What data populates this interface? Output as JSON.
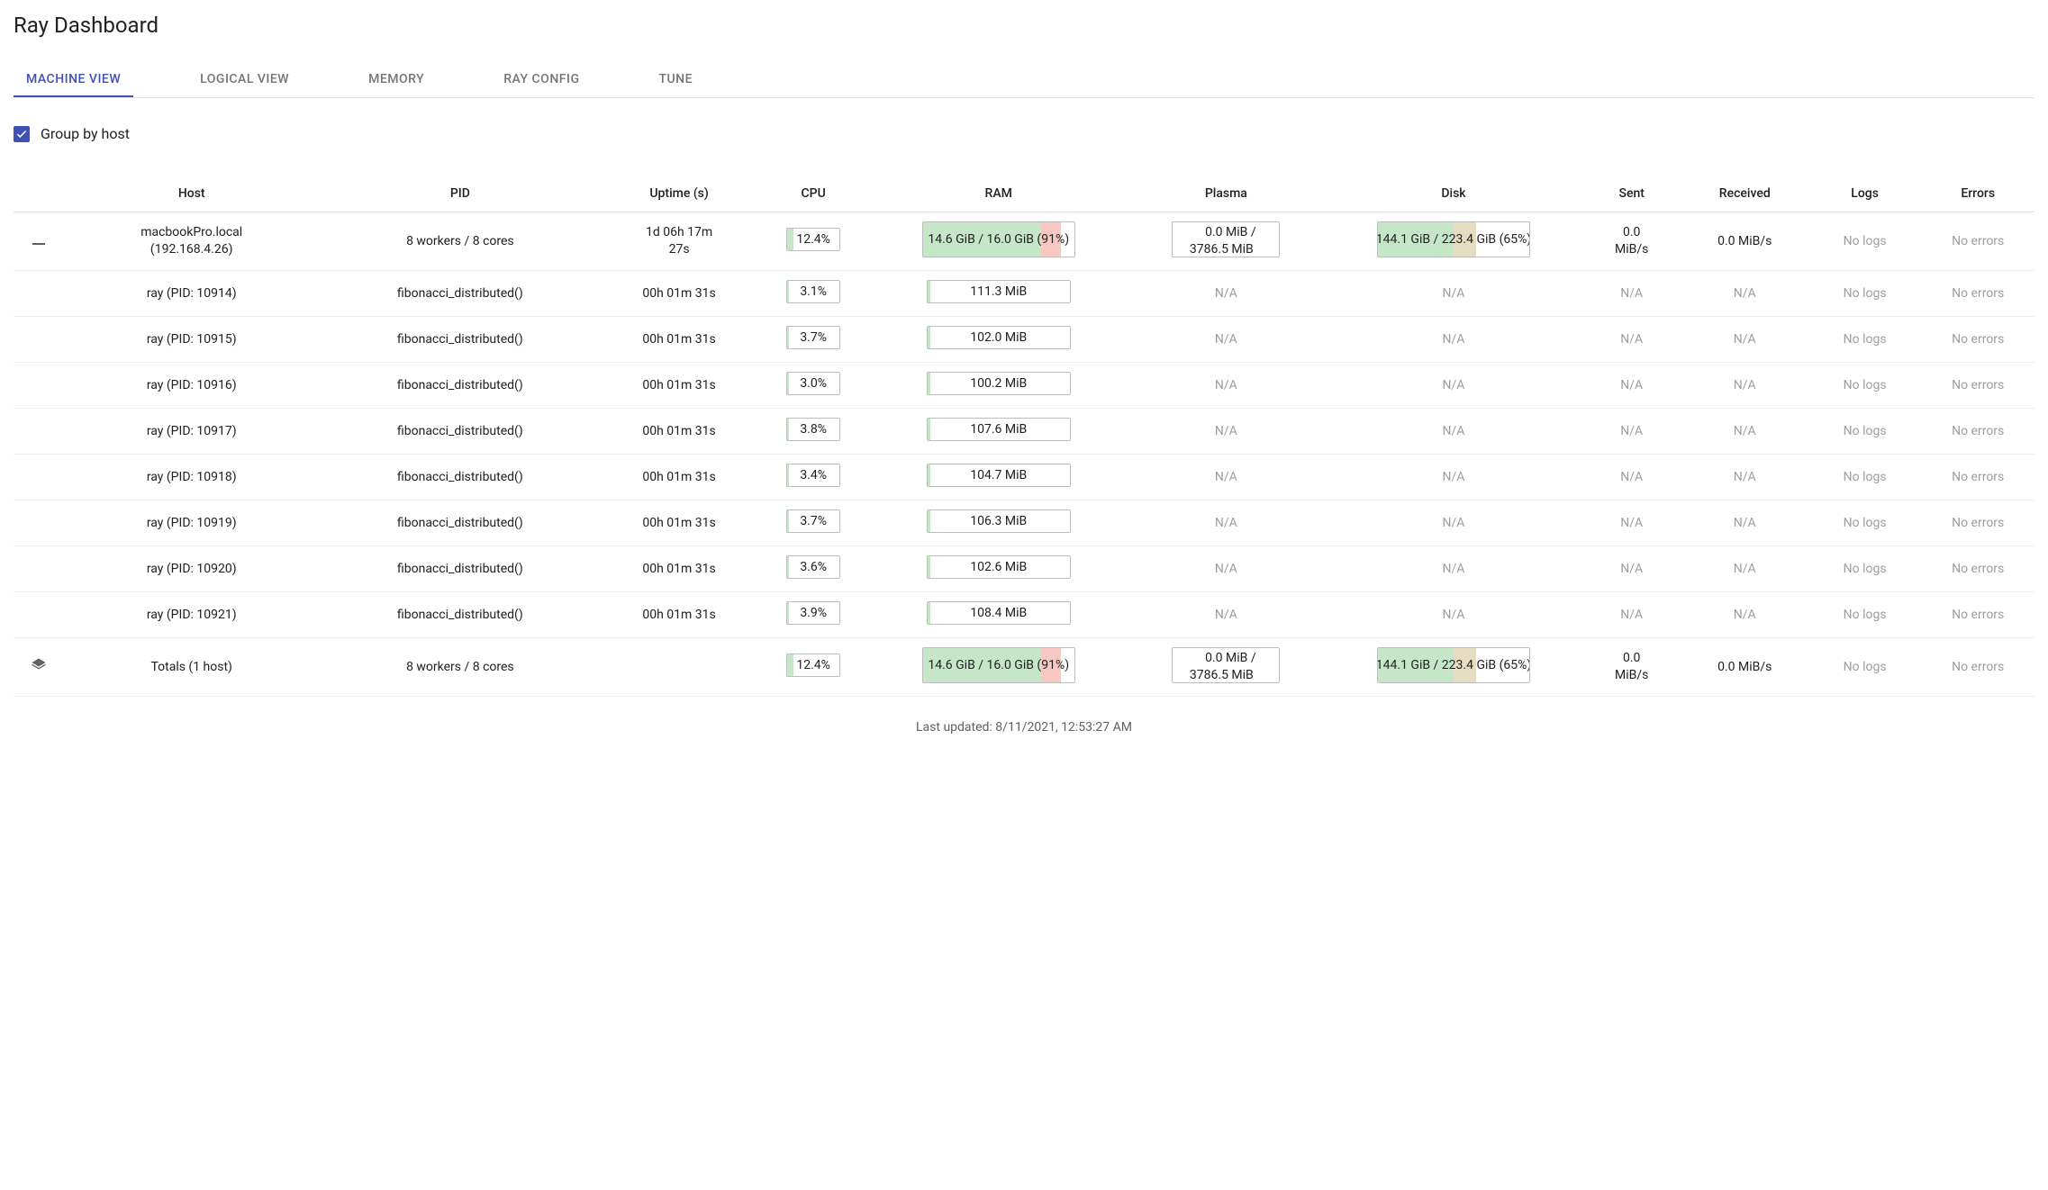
{
  "title": "Ray Dashboard",
  "tabs": [
    {
      "label": "MACHINE VIEW",
      "active": true
    },
    {
      "label": "LOGICAL VIEW",
      "active": false
    },
    {
      "label": "MEMORY",
      "active": false
    },
    {
      "label": "RAY CONFIG",
      "active": false
    },
    {
      "label": "TUNE",
      "active": false
    }
  ],
  "groupByHost": {
    "checked": true,
    "label": "Group by host"
  },
  "columns": {
    "host": "Host",
    "pid": "PID",
    "uptime": "Uptime (s)",
    "cpu": "CPU",
    "ram": "RAM",
    "plasma": "Plasma",
    "disk": "Disk",
    "sent": "Sent",
    "received": "Received",
    "logs": "Logs",
    "errors": "Errors"
  },
  "hostRow": {
    "hostname": "macbookPro.local",
    "ip": "(192.168.4.26)",
    "pid": "8 workers / 8 cores",
    "uptime": "1d 06h 17m 27s",
    "cpu": {
      "text": "12.4%",
      "pct": 12.4
    },
    "ram": {
      "text": "14.6 GiB / 16.0 GiB (91%)",
      "pct": 91,
      "greenPct": 78
    },
    "plasma": {
      "line1": "0.0 MiB /",
      "line2": "3786.5 MiB"
    },
    "disk": {
      "text": "144.1 GiB / 223.4 GiB (65%)",
      "pct": 65,
      "greenPct": 50
    },
    "sent": "0.0 MiB/s",
    "received": "0.0 MiB/s",
    "logs": "No logs",
    "errors": "No errors"
  },
  "workers": [
    {
      "host": "ray (PID: 10914)",
      "pid": "fibonacci_distributed()",
      "uptime": "00h 01m 31s",
      "cpu": {
        "text": "3.1%",
        "pct": 3.1
      },
      "ram": "111.3 MiB",
      "plasma": "N/A",
      "disk": "N/A",
      "sent": "N/A",
      "received": "N/A",
      "logs": "No logs",
      "errors": "No errors"
    },
    {
      "host": "ray (PID: 10915)",
      "pid": "fibonacci_distributed()",
      "uptime": "00h 01m 31s",
      "cpu": {
        "text": "3.7%",
        "pct": 3.7
      },
      "ram": "102.0 MiB",
      "plasma": "N/A",
      "disk": "N/A",
      "sent": "N/A",
      "received": "N/A",
      "logs": "No logs",
      "errors": "No errors"
    },
    {
      "host": "ray (PID: 10916)",
      "pid": "fibonacci_distributed()",
      "uptime": "00h 01m 31s",
      "cpu": {
        "text": "3.0%",
        "pct": 3.0
      },
      "ram": "100.2 MiB",
      "plasma": "N/A",
      "disk": "N/A",
      "sent": "N/A",
      "received": "N/A",
      "logs": "No logs",
      "errors": "No errors"
    },
    {
      "host": "ray (PID: 10917)",
      "pid": "fibonacci_distributed()",
      "uptime": "00h 01m 31s",
      "cpu": {
        "text": "3.8%",
        "pct": 3.8
      },
      "ram": "107.6 MiB",
      "plasma": "N/A",
      "disk": "N/A",
      "sent": "N/A",
      "received": "N/A",
      "logs": "No logs",
      "errors": "No errors"
    },
    {
      "host": "ray (PID: 10918)",
      "pid": "fibonacci_distributed()",
      "uptime": "00h 01m 31s",
      "cpu": {
        "text": "3.4%",
        "pct": 3.4
      },
      "ram": "104.7 MiB",
      "plasma": "N/A",
      "disk": "N/A",
      "sent": "N/A",
      "received": "N/A",
      "logs": "No logs",
      "errors": "No errors"
    },
    {
      "host": "ray (PID: 10919)",
      "pid": "fibonacci_distributed()",
      "uptime": "00h 01m 31s",
      "cpu": {
        "text": "3.7%",
        "pct": 3.7
      },
      "ram": "106.3 MiB",
      "plasma": "N/A",
      "disk": "N/A",
      "sent": "N/A",
      "received": "N/A",
      "logs": "No logs",
      "errors": "No errors"
    },
    {
      "host": "ray (PID: 10920)",
      "pid": "fibonacci_distributed()",
      "uptime": "00h 01m 31s",
      "cpu": {
        "text": "3.6%",
        "pct": 3.6
      },
      "ram": "102.6 MiB",
      "plasma": "N/A",
      "disk": "N/A",
      "sent": "N/A",
      "received": "N/A",
      "logs": "No logs",
      "errors": "No errors"
    },
    {
      "host": "ray (PID: 10921)",
      "pid": "fibonacci_distributed()",
      "uptime": "00h 01m 31s",
      "cpu": {
        "text": "3.9%",
        "pct": 3.9
      },
      "ram": "108.4 MiB",
      "plasma": "N/A",
      "disk": "N/A",
      "sent": "N/A",
      "received": "N/A",
      "logs": "No logs",
      "errors": "No errors"
    }
  ],
  "totalsRow": {
    "host": "Totals (1 host)",
    "pid": "8 workers / 8 cores",
    "uptime": "",
    "cpu": {
      "text": "12.4%",
      "pct": 12.4
    },
    "ram": {
      "text": "14.6 GiB / 16.0 GiB (91%)",
      "pct": 91,
      "greenPct": 78
    },
    "plasma": {
      "line1": "0.0 MiB /",
      "line2": "3786.5 MiB"
    },
    "disk": {
      "text": "144.1 GiB / 223.4 GiB (65%)",
      "pct": 65,
      "greenPct": 50
    },
    "sent": "0.0 MiB/s",
    "received": "0.0 MiB/s",
    "logs": "No logs",
    "errors": "No errors"
  },
  "footer": "Last updated: 8/11/2021, 12:53:27 AM"
}
